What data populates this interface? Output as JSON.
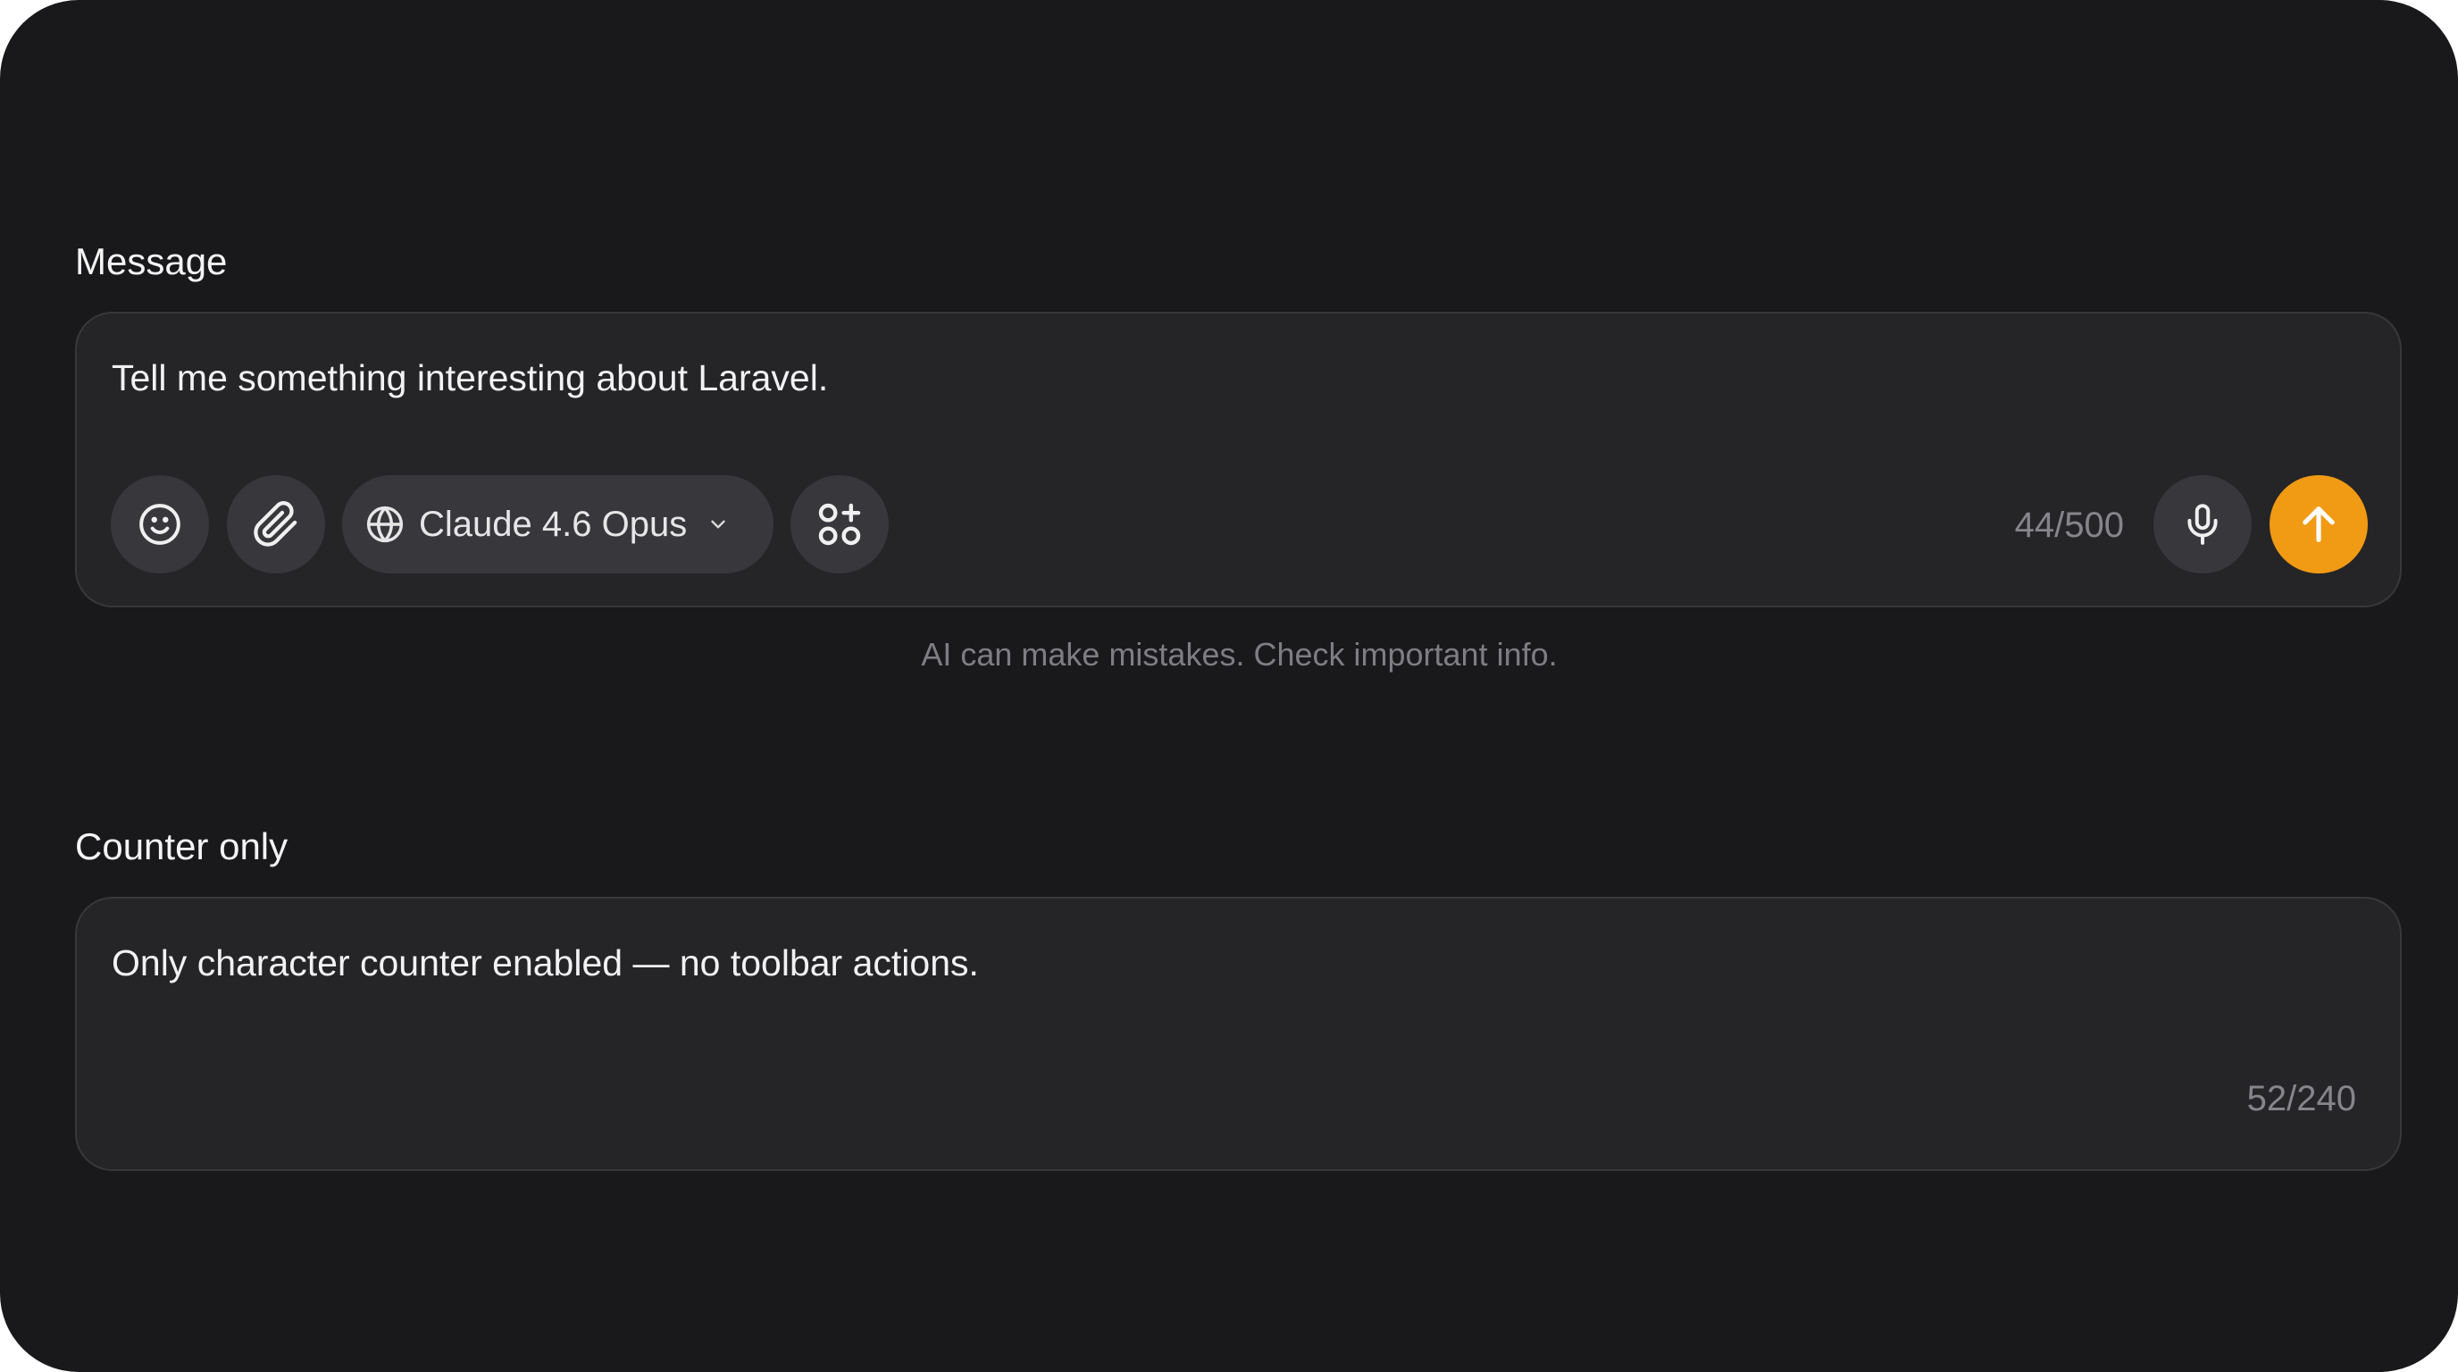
{
  "sections": {
    "message": {
      "label": "Message",
      "input_value": "Tell me something interesting about Laravel.",
      "counter": "44/500",
      "model_selector": {
        "label": "Claude 4.6 Opus",
        "icon": "globe-icon"
      },
      "toolbar_icons": [
        "emoji-icon",
        "paperclip-icon",
        "apps-plus-icon"
      ],
      "mic_icon": "microphone-icon",
      "send_icon": "arrow-up-icon",
      "disclaimer": "AI can make mistakes. Check important info."
    },
    "counter_only": {
      "label": "Counter only",
      "input_value": "Only character counter enabled — no toolbar actions.",
      "counter": "52/240"
    }
  },
  "colors": {
    "background": "#19191b",
    "composer_bg": "#252528",
    "button_bg": "#38383c",
    "accent": "#f19a13",
    "muted_text": "#85858b"
  }
}
